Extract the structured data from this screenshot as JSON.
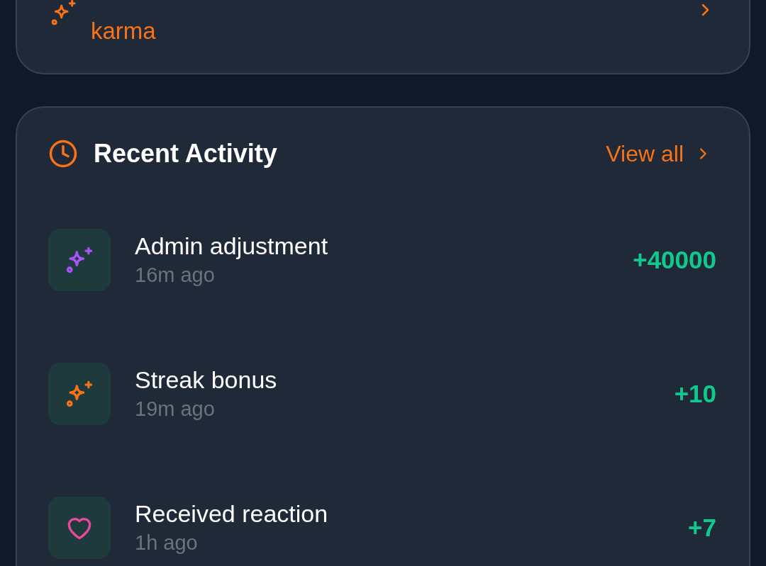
{
  "learn_link": {
    "label": "karma"
  },
  "recent_activity": {
    "title": "Recent Activity",
    "view_all": "View all",
    "items": [
      {
        "kind": "sparkle",
        "color": "#a855f7",
        "title": "Admin adjustment",
        "time": "16m ago",
        "amount": "+40000"
      },
      {
        "kind": "sparkle",
        "color": "#f97316",
        "title": "Streak bonus",
        "time": "19m ago",
        "amount": "+10"
      },
      {
        "kind": "heart",
        "color": "#ec4899",
        "title": "Received reaction",
        "time": "1h ago",
        "amount": "+7"
      }
    ]
  }
}
